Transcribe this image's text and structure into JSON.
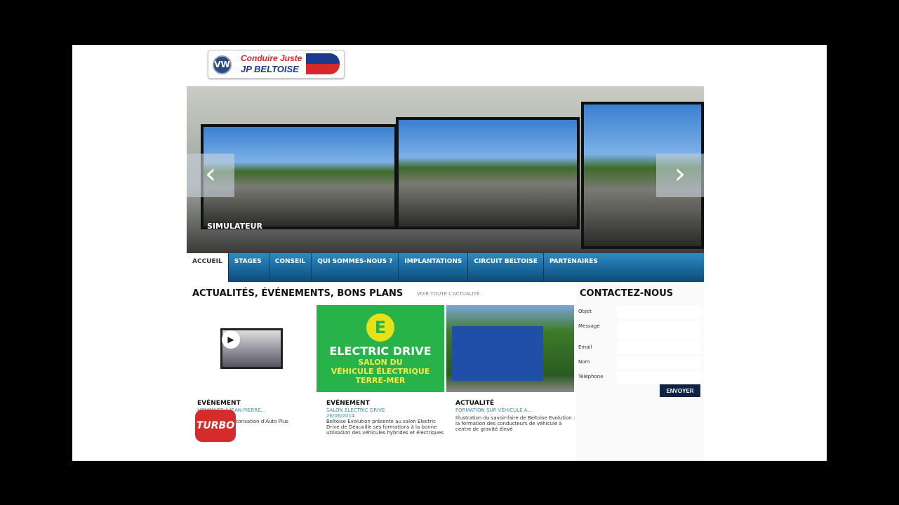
{
  "logo": {
    "brand": "VW",
    "line1": "Conduire Juste",
    "line2": "JP BELTOISE"
  },
  "hero": {
    "caption": "SIMULATEUR",
    "prev": "‹",
    "next": "›"
  },
  "nav": [
    "ACCUEIL",
    "STAGES",
    "CONSEIL",
    "QUI SOMMES-NOUS ?",
    "IMPLANTATIONS",
    "CIRCUIT BELTOISE",
    "PARTENAIRES"
  ],
  "news": {
    "title": "ACTUALITÉS, ÉVÉNEMENTS, BONS PLANS",
    "see_all": "VOIR TOUTE L'ACTUALITÉ",
    "items": [
      {
        "type": "EVÉNEMENT",
        "subtitle": "HOMMAGE À JEAN-PIERRE...",
        "date": "",
        "text": "...autorisation d'Auto Plus"
      },
      {
        "type": "EVÉNEMENT",
        "subtitle": "SALON ELECTRIC DRIVE",
        "date": "26/06/2014",
        "text": "Beltoise Evolution présente au salon Electric Drive de Deauville ses formations à la bonne utilisation des véhicules hybrides et électriques"
      },
      {
        "type": "ACTUALITÉ",
        "subtitle": "FORMATION SUR VÉHICULE A...",
        "date": "",
        "text": "Illustration du savoir-faire de Beltoise Evolution : la formation des conducteurs de véhicule à centre de gravité élevé"
      }
    ],
    "banner": {
      "logo": "E",
      "l1": "ELECTRIC DRIVE",
      "l2": "SALON DU",
      "l3": "VÉHICULE ÉLECTRIQUE",
      "l4": "TERRE-MER"
    }
  },
  "contact": {
    "title": "CONTACTEZ-NOUS",
    "fields": [
      "Objet",
      "Message",
      "Email",
      "Nom",
      "Téléphone"
    ],
    "submit": "ENVOYER"
  },
  "overlay": {
    "turbo": "TURBO"
  }
}
